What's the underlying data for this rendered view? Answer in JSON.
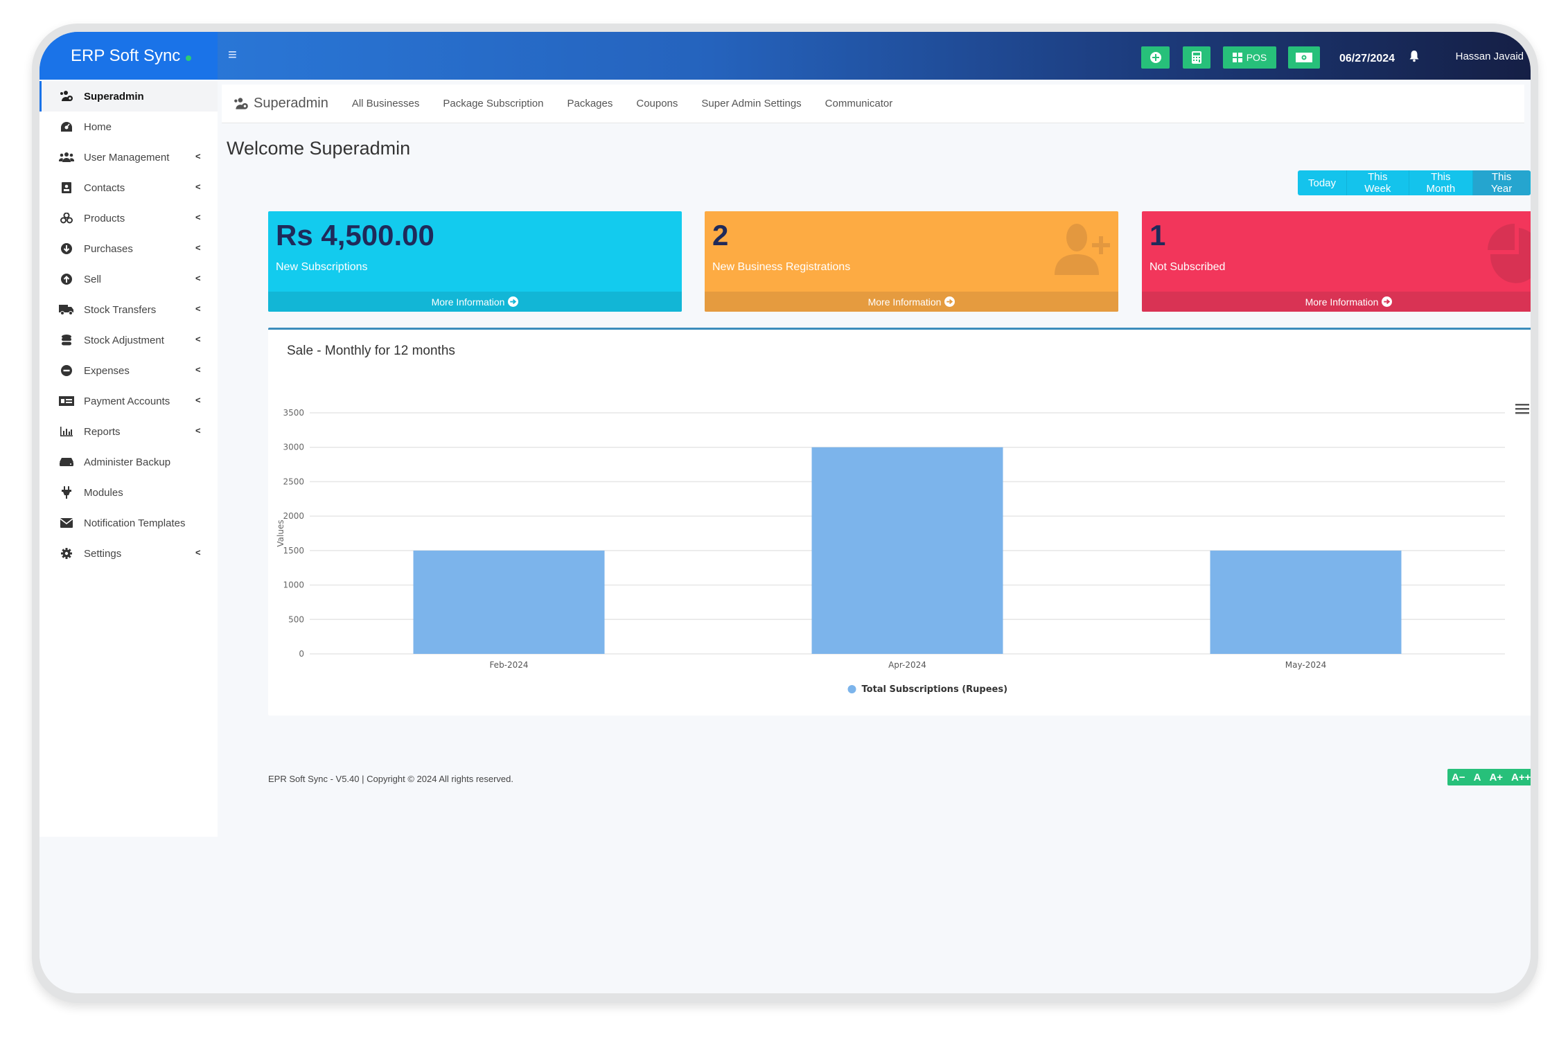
{
  "app": {
    "brand": "ERP Soft Sync",
    "status_dot_color": "#2ecc71"
  },
  "header": {
    "toolbar": [
      {
        "name": "add-button",
        "icon": "plus-circle-icon",
        "label": ""
      },
      {
        "name": "calculator-button",
        "icon": "calculator-icon",
        "label": ""
      },
      {
        "name": "pos-button",
        "icon": "grid-icon",
        "label": "POS"
      },
      {
        "name": "cash-button",
        "icon": "money-icon",
        "label": ""
      }
    ],
    "date": "06/27/2024",
    "user": "Hassan Javaid"
  },
  "sidebar": {
    "items": [
      {
        "label": "Superadmin",
        "icon": "users-cog-icon",
        "active": true,
        "submenu": false
      },
      {
        "label": "Home",
        "icon": "dashboard-icon",
        "submenu": false
      },
      {
        "label": "User Management",
        "icon": "users-icon",
        "submenu": true
      },
      {
        "label": "Contacts",
        "icon": "address-book-icon",
        "submenu": true
      },
      {
        "label": "Products",
        "icon": "cubes-icon",
        "submenu": true
      },
      {
        "label": "Purchases",
        "icon": "arrow-circle-down-icon",
        "submenu": true
      },
      {
        "label": "Sell",
        "icon": "arrow-circle-up-icon",
        "submenu": true
      },
      {
        "label": "Stock Transfers",
        "icon": "truck-icon",
        "submenu": true
      },
      {
        "label": "Stock Adjustment",
        "icon": "database-icon",
        "submenu": true
      },
      {
        "label": "Expenses",
        "icon": "minus-circle-icon",
        "submenu": true
      },
      {
        "label": "Payment Accounts",
        "icon": "money-check-icon",
        "submenu": true
      },
      {
        "label": "Reports",
        "icon": "bar-chart-icon",
        "submenu": true
      },
      {
        "label": "Administer Backup",
        "icon": "hdd-icon",
        "submenu": false
      },
      {
        "label": "Modules",
        "icon": "plug-icon",
        "submenu": false
      },
      {
        "label": "Notification Templates",
        "icon": "envelope-icon",
        "submenu": false
      },
      {
        "label": "Settings",
        "icon": "gear-icon",
        "submenu": true
      }
    ]
  },
  "subnav": {
    "home": "Superadmin",
    "links": [
      "All Businesses",
      "Package Subscription",
      "Packages",
      "Coupons",
      "Super Admin Settings",
      "Communicator"
    ]
  },
  "main": {
    "welcome": "Welcome Superadmin",
    "ranges": [
      {
        "label": "Today",
        "active": false
      },
      {
        "label": "This Week",
        "active": false
      },
      {
        "label": "This Month",
        "active": false
      },
      {
        "label": "This Year",
        "active": true
      }
    ],
    "stats": [
      {
        "value": "Rs 4,500.00",
        "label": "New Subscriptions",
        "link": "More Information",
        "color": "#13cbee"
      },
      {
        "value": "2",
        "label": "New Business Registrations",
        "link": "More Information",
        "color": "#fdab43"
      },
      {
        "value": "1",
        "label": "Not Subscribed",
        "link": "More Information",
        "color": "#f2365b"
      }
    ]
  },
  "chart_data": {
    "type": "bar",
    "title": "Sale - Monthly for 12 months",
    "categories": [
      "Feb-2024",
      "Apr-2024",
      "May-2024"
    ],
    "series": [
      {
        "name": "Total Subscriptions (Rupees)",
        "values": [
          1500,
          3000,
          1500
        ],
        "color": "#7cb4eb"
      }
    ],
    "xlabel": "",
    "ylabel": "Values",
    "ylim": [
      0,
      3500
    ],
    "yticks": [
      0,
      500,
      1000,
      1500,
      2000,
      2500,
      3000,
      3500
    ],
    "grid": true,
    "legend": "bottom-center"
  },
  "footer": {
    "text": "EPR Soft Sync - V5.40 | Copyright © 2024 All rights reserved.",
    "font_controls": [
      "A−",
      "A",
      "A+",
      "A++"
    ]
  }
}
